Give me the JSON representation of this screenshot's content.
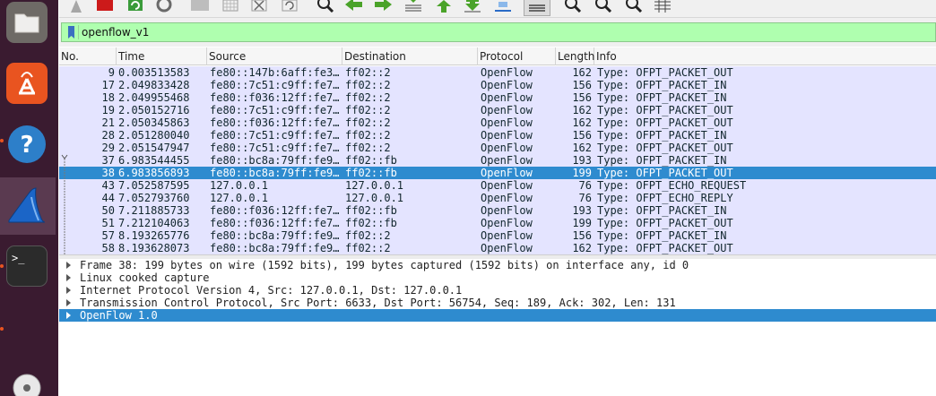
{
  "filter": {
    "value": "openflow_v1"
  },
  "columns": [
    "No.",
    "Time",
    "Source",
    "Destination",
    "Protocol",
    "Length",
    "Info"
  ],
  "packets": [
    {
      "no": "9",
      "time": "0.003513583",
      "src": "fe80::147b:6aff:fe3…",
      "dst": "ff02::2",
      "proto": "OpenFlow",
      "len": "162",
      "info": "Type: OFPT_PACKET_OUT"
    },
    {
      "no": "17",
      "time": "2.049833428",
      "src": "fe80::7c51:c9ff:fe7…",
      "dst": "ff02::2",
      "proto": "OpenFlow",
      "len": "156",
      "info": "Type: OFPT_PACKET_IN"
    },
    {
      "no": "18",
      "time": "2.049955468",
      "src": "fe80::f036:12ff:fe7…",
      "dst": "ff02::2",
      "proto": "OpenFlow",
      "len": "156",
      "info": "Type: OFPT_PACKET_IN"
    },
    {
      "no": "19",
      "time": "2.050152716",
      "src": "fe80::7c51:c9ff:fe7…",
      "dst": "ff02::2",
      "proto": "OpenFlow",
      "len": "162",
      "info": "Type: OFPT_PACKET_OUT"
    },
    {
      "no": "21",
      "time": "2.050345863",
      "src": "fe80::f036:12ff:fe7…",
      "dst": "ff02::2",
      "proto": "OpenFlow",
      "len": "162",
      "info": "Type: OFPT_PACKET_OUT"
    },
    {
      "no": "28",
      "time": "2.051280040",
      "src": "fe80::7c51:c9ff:fe7…",
      "dst": "ff02::2",
      "proto": "OpenFlow",
      "len": "156",
      "info": "Type: OFPT_PACKET_IN"
    },
    {
      "no": "29",
      "time": "2.051547947",
      "src": "fe80::7c51:c9ff:fe7…",
      "dst": "ff02::2",
      "proto": "OpenFlow",
      "len": "162",
      "info": "Type: OFPT_PACKET_OUT"
    },
    {
      "no": "37",
      "time": "6.983544455",
      "src": "fe80::bc8a:79ff:fe9…",
      "dst": "ff02::fb",
      "proto": "OpenFlow",
      "len": "193",
      "info": "Type: OFPT_PACKET_IN"
    },
    {
      "no": "38",
      "time": "6.983856893",
      "src": "fe80::bc8a:79ff:fe9…",
      "dst": "ff02::fb",
      "proto": "OpenFlow",
      "len": "199",
      "info": "Type: OFPT_PACKET_OUT"
    },
    {
      "no": "43",
      "time": "7.052587595",
      "src": "127.0.0.1",
      "dst": "127.0.0.1",
      "proto": "OpenFlow",
      "len": "76",
      "info": "Type: OFPT_ECHO_REQUEST"
    },
    {
      "no": "44",
      "time": "7.052793760",
      "src": "127.0.0.1",
      "dst": "127.0.0.1",
      "proto": "OpenFlow",
      "len": "76",
      "info": "Type: OFPT_ECHO_REPLY"
    },
    {
      "no": "50",
      "time": "7.211885733",
      "src": "fe80::f036:12ff:fe7…",
      "dst": "ff02::fb",
      "proto": "OpenFlow",
      "len": "193",
      "info": "Type: OFPT_PACKET_IN"
    },
    {
      "no": "51",
      "time": "7.212104063",
      "src": "fe80::f036:12ff:fe7…",
      "dst": "ff02::fb",
      "proto": "OpenFlow",
      "len": "199",
      "info": "Type: OFPT_PACKET_OUT"
    },
    {
      "no": "57",
      "time": "8.193265776",
      "src": "fe80::bc8a:79ff:fe9…",
      "dst": "ff02::2",
      "proto": "OpenFlow",
      "len": "156",
      "info": "Type: OFPT_PACKET_IN"
    },
    {
      "no": "58",
      "time": "8.193628073",
      "src": "fe80::bc8a:79ff:fe9…",
      "dst": "ff02::2",
      "proto": "OpenFlow",
      "len": "162",
      "info": "Type: OFPT_PACKET_OUT"
    }
  ],
  "selected_packet_index": 8,
  "details": [
    "Frame 38: 199 bytes on wire (1592 bits), 199 bytes captured (1592 bits) on interface any, id 0",
    "Linux cooked capture",
    "Internet Protocol Version 4, Src: 127.0.0.1, Dst: 127.0.0.1",
    "Transmission Control Protocol, Src Port: 6633, Dst Port: 56754, Seq: 189, Ack: 302, Len: 131",
    "OpenFlow 1.0"
  ],
  "selected_detail_index": 4,
  "dock": [
    "files-icon",
    "app-store-icon",
    "help-icon",
    "wireshark-icon",
    "terminal-icon",
    "disc-icon"
  ],
  "terminal_prompt": ">_",
  "colors": {
    "row_bg": "#e4e4ff",
    "selected": "#2e8bcf",
    "filter_ok": "#afffaf",
    "dock_bg": "#3a1b30"
  }
}
